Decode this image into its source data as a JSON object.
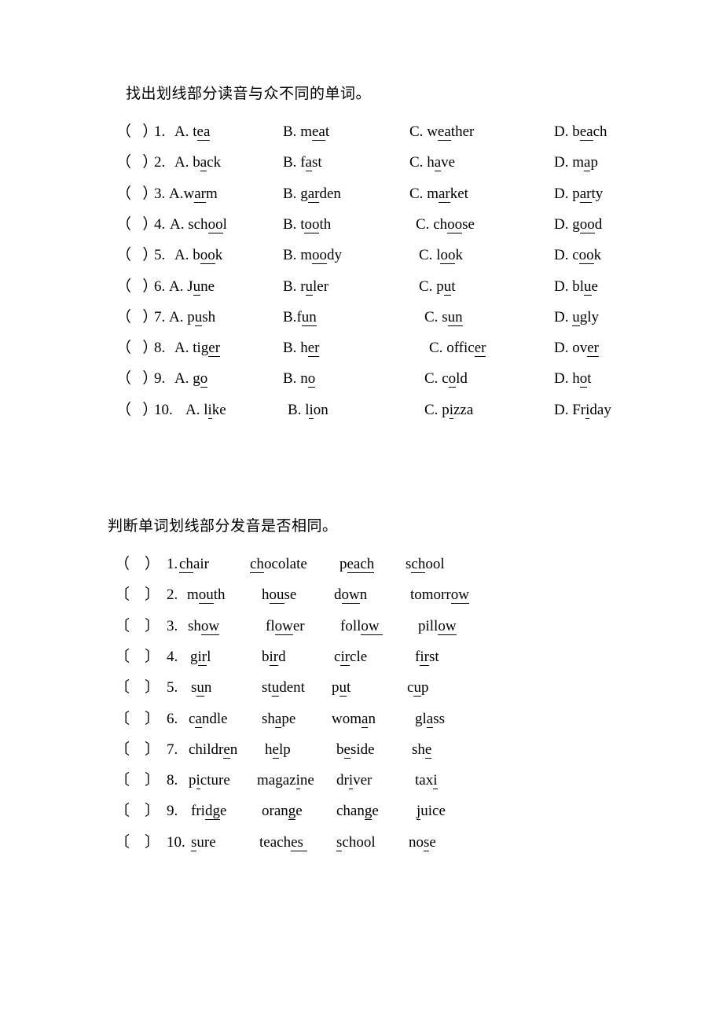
{
  "sections": [
    {
      "id": "section-odd-one-out",
      "heading": "找出划线部分读音与众不同的单词。",
      "bracket_open": "（",
      "bracket_close": "）",
      "rows": [
        {
          "number": "1.",
          "options": [
            {
              "label": "A. ",
              "pre": "t",
              "mark": "ea",
              "post": ""
            },
            {
              "label": "B. ",
              "pre": "m",
              "mark": "ea",
              "post": "t"
            },
            {
              "label": "C. ",
              "pre": "w",
              "mark": "ea",
              "post": "ther"
            },
            {
              "label": "D. ",
              "pre": "b",
              "mark": "ea",
              "post": "ch"
            }
          ]
        },
        {
          "number": "2.",
          "options": [
            {
              "label": "A. ",
              "pre": "b",
              "mark": "a",
              "post": "ck"
            },
            {
              "label": "B. ",
              "pre": "f",
              "mark": "a",
              "post": "st"
            },
            {
              "label": "C. ",
              "pre": "h",
              "mark": "a",
              "post": "ve"
            },
            {
              "label": "D. ",
              "pre": "m",
              "mark": "a",
              "post": "p"
            }
          ]
        },
        {
          "number": "3.",
          "options": [
            {
              "label": "A.",
              "pre": "w",
              "mark": "ar",
              "post": "m"
            },
            {
              "label": "B. ",
              "pre": "g",
              "mark": "ar",
              "post": "den"
            },
            {
              "label": "C. ",
              "pre": "m",
              "mark": "ar",
              "post": "ket"
            },
            {
              "label": "D. ",
              "pre": "p",
              "mark": "ar",
              "post": "ty"
            }
          ]
        },
        {
          "number": "4.",
          "options": [
            {
              "label": "A. ",
              "pre": "sch",
              "mark": "oo",
              "post": "l"
            },
            {
              "label": "B. ",
              "pre": "t",
              "mark": "oo",
              "post": "th"
            },
            {
              "label": "C. ",
              "pre": "ch",
              "mark": "oo",
              "post": "se"
            },
            {
              "label": "D. ",
              "pre": "g",
              "mark": "oo",
              "post": "d"
            }
          ]
        },
        {
          "number": "5.",
          "options": [
            {
              "label": "A. ",
              "pre": "b",
              "mark": "oo",
              "post": "k"
            },
            {
              "label": "B. ",
              "pre": "m",
              "mark": "oo",
              "post": "dy"
            },
            {
              "label": "C. ",
              "pre": "l",
              "mark": "oo",
              "post": "k"
            },
            {
              "label": "D. ",
              "pre": "c",
              "mark": "oo",
              "post": "k"
            }
          ]
        },
        {
          "number": "6.",
          "options": [
            {
              "label": "A. ",
              "pre": "J",
              "mark": "u",
              "post": "ne"
            },
            {
              "label": "B. ",
              "pre": "r",
              "mark": "u",
              "post": "ler"
            },
            {
              "label": "C. ",
              "pre": "p",
              "mark": "u",
              "post": "t"
            },
            {
              "label": "D. ",
              "pre": "bl",
              "mark": "u",
              "post": "e"
            }
          ]
        },
        {
          "number": "7.",
          "options": [
            {
              "label": "A. ",
              "pre": "p",
              "mark": "u",
              "post": "sh"
            },
            {
              "label": "B.",
              "pre": "f",
              "mark": "un",
              "post": ""
            },
            {
              "label": "C. ",
              "pre": "s",
              "mark": "un",
              "post": ""
            },
            {
              "label": "D. ",
              "pre": "",
              "mark": "u",
              "post": "gly"
            }
          ]
        },
        {
          "number": "8.",
          "options": [
            {
              "label": "A. ",
              "pre": "tig",
              "mark": "er",
              "post": ""
            },
            {
              "label": "B. ",
              "pre": "h",
              "mark": "er",
              "post": ""
            },
            {
              "label": "C. ",
              "pre": "offic",
              "mark": "er",
              "post": ""
            },
            {
              "label": "D. ",
              "pre": "ov",
              "mark": "er",
              "post": ""
            }
          ]
        },
        {
          "number": "9.",
          "options": [
            {
              "label": "A. ",
              "pre": "g",
              "mark": "o",
              "post": ""
            },
            {
              "label": "B. ",
              "pre": "n",
              "mark": "o",
              "post": ""
            },
            {
              "label": "C. ",
              "pre": "c",
              "mark": "o",
              "post": "ld"
            },
            {
              "label": "D. ",
              "pre": "h",
              "mark": "o",
              "post": "t"
            }
          ]
        },
        {
          "number": "10.",
          "options": [
            {
              "label": "A. ",
              "pre": "l",
              "mark": "i",
              "post": "ke"
            },
            {
              "label": "B. ",
              "pre": "l",
              "mark": "i",
              "post": "on"
            },
            {
              "label": "C. ",
              "pre": "p",
              "mark": "i",
              "post": "zza"
            },
            {
              "label": "D. ",
              "pre": "Fr",
              "mark": "i",
              "post": "day"
            }
          ]
        }
      ]
    },
    {
      "id": "section-same-sound",
      "heading": "判断单词划线部分发音是否相同。",
      "bracket_open_first": "（",
      "bracket_close_first": "）",
      "bracket_open": "〔",
      "bracket_close": "〕",
      "rows": [
        {
          "number": "1.",
          "words": [
            {
              "pre": "",
              "mark": "ch",
              "post": "air"
            },
            {
              "pre": "",
              "mark": "ch",
              "post": "ocolate"
            },
            {
              "pre": "p",
              "mark": "ea",
              "post": "ch",
              "mark2": "ch"
            },
            {
              "pre": "s",
              "mark": "ch",
              "post": "ool"
            }
          ]
        },
        {
          "number": "2.",
          "words": [
            {
              "pre": "m",
              "mark": "ou",
              "post": "th"
            },
            {
              "pre": "h",
              "mark": "ou",
              "post": "se"
            },
            {
              "pre": "d",
              "mark": "ow",
              "post": "n"
            },
            {
              "pre": "tomorr",
              "mark": "ow",
              "post": ""
            }
          ]
        },
        {
          "number": "3.",
          "words": [
            {
              "pre": "sh",
              "mark": "ow",
              "post": ""
            },
            {
              "pre": "fl",
              "mark": "ow",
              "post": "er"
            },
            {
              "pre": "foll",
              "mark": "ow ",
              "post": ""
            },
            {
              "pre": "pill",
              "mark": "ow",
              "post": ""
            }
          ]
        },
        {
          "number": "4.",
          "words": [
            {
              "pre": "g",
              "mark": "ir",
              "post": "l"
            },
            {
              "pre": "b",
              "mark": "ir",
              "post": "d"
            },
            {
              "pre": "c",
              "mark": "ir",
              "post": "cle"
            },
            {
              "pre": "f",
              "mark": "ir",
              "post": "st"
            }
          ]
        },
        {
          "number": "5.",
          "words": [
            {
              "pre": "s",
              "mark": "u",
              "post": "n"
            },
            {
              "pre": "st",
              "mark": "u",
              "post": "dent"
            },
            {
              "pre": "p",
              "mark": "u",
              "post": "t"
            },
            {
              "pre": "c",
              "mark": "u",
              "post": "p"
            }
          ]
        },
        {
          "number": "6.",
          "words": [
            {
              "pre": "c",
              "mark": "a",
              "post": "ndle"
            },
            {
              "pre": "sh",
              "mark": "a",
              "post": "pe"
            },
            {
              "pre": "wom",
              "mark": "a",
              "post": "n"
            },
            {
              "pre": "gl",
              "mark": "a",
              "post": "ss"
            }
          ]
        },
        {
          "number": "7.",
          "words": [
            {
              "pre": "childr",
              "mark": "e",
              "post": "n"
            },
            {
              "pre": "h",
              "mark": "e",
              "post": "lp"
            },
            {
              "pre": "b",
              "mark": "e",
              "post": "side"
            },
            {
              "pre": "sh",
              "mark": "e",
              "post": ""
            }
          ]
        },
        {
          "number": "8.",
          "words": [
            {
              "pre": "p",
              "mark": "i",
              "post": "cture"
            },
            {
              "pre": "magaz",
              "mark": "i",
              "post": "ne"
            },
            {
              "pre": "dr",
              "mark": "i",
              "post": "ver"
            },
            {
              "pre": "tax",
              "mark": "i",
              "post": ""
            }
          ]
        },
        {
          "number": "9.",
          "words": [
            {
              "pre": "fri",
              "mark": "dg",
              "post": "e"
            },
            {
              "pre": "oran",
              "mark": "g",
              "post": "e"
            },
            {
              "pre": "chan",
              "mark": "g",
              "post": "e"
            },
            {
              "pre": "",
              "mark": "j",
              "post": "uice"
            }
          ]
        },
        {
          "number": "10.",
          "words": [
            {
              "pre": "",
              "mark": "s",
              "post": "ure"
            },
            {
              "pre": "teach",
              "mark": "es ",
              "post": ""
            },
            {
              "pre": "",
              "mark": "s",
              "post": "chool"
            },
            {
              "pre": "no",
              "mark": "s",
              "post": "e"
            }
          ]
        }
      ]
    }
  ]
}
